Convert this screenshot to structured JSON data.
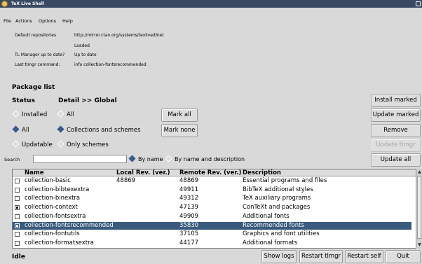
{
  "window": {
    "title": "TeX Live Shell"
  },
  "menu": [
    {
      "label": "File"
    },
    {
      "label": "Actions"
    },
    {
      "label": "Options"
    },
    {
      "label": "Help"
    }
  ],
  "info": [
    {
      "label": "Default repositories",
      "value": "http://mirror.ctan.org/systems/texlive/tlnet"
    },
    {
      "label": "",
      "value": "Loaded"
    },
    {
      "label": "TL Manager up to date?",
      "value": "Up to date"
    },
    {
      "label": "Last tlmgr command:",
      "value": "info collection-fontsrecommended"
    }
  ],
  "package_list": {
    "title": "Package list",
    "status_header": "Status",
    "detail_header": "Detail >> Global",
    "status_options": [
      {
        "label": "Installed",
        "selected": false
      },
      {
        "label": "All",
        "selected": true
      },
      {
        "label": "Updatable",
        "selected": false
      }
    ],
    "detail_options": [
      {
        "label": "All",
        "selected": false
      },
      {
        "label": "Collections and schemes",
        "selected": true
      },
      {
        "label": "Only schemes",
        "selected": false
      }
    ],
    "mark_all": "Mark all",
    "mark_none": "Mark none"
  },
  "actions": {
    "install_marked": "Install marked",
    "update_marked": "Update marked",
    "remove_marked": "Remove marked",
    "update_tlmgr": "Update tlmgr",
    "update_all": "Update all"
  },
  "search": {
    "label": "Search",
    "value": "",
    "by_name": "By name",
    "by_name_desc": "By name and description",
    "mode": "by_name"
  },
  "table": {
    "columns": [
      "Name",
      "Local Rev. (ver.)",
      "Remote Rev. (ver.)",
      "Description"
    ],
    "rows": [
      {
        "checked": false,
        "name": "collection-basic",
        "local": "48869",
        "remote": "48869",
        "desc": "Essential programs and files",
        "selected": false
      },
      {
        "checked": false,
        "name": "collection-bibtexextra",
        "local": "",
        "remote": "49911",
        "desc": "BibTeX additional styles",
        "selected": false
      },
      {
        "checked": false,
        "name": "collection-binextra",
        "local": "",
        "remote": "49312",
        "desc": "TeX auxiliary programs",
        "selected": false
      },
      {
        "checked": true,
        "name": "collection-context",
        "local": "",
        "remote": "47139",
        "desc": "ConTeXt and packages",
        "selected": false
      },
      {
        "checked": false,
        "name": "collection-fontsextra",
        "local": "",
        "remote": "49909",
        "desc": "Additional fonts",
        "selected": false
      },
      {
        "checked": true,
        "name": "collection-fontsrecommended",
        "local": "",
        "remote": "35830",
        "desc": "Recommended fonts",
        "selected": true
      },
      {
        "checked": false,
        "name": "collection-fontutils",
        "local": "",
        "remote": "37105",
        "desc": "Graphics and font utilities",
        "selected": false
      },
      {
        "checked": false,
        "name": "collection-formatsextra",
        "local": "",
        "remote": "44177",
        "desc": "Additional formats",
        "selected": false
      }
    ]
  },
  "bottom": {
    "status": "Idle",
    "show_logs": "Show logs",
    "restart_tlmgr": "Restart tlmgr",
    "restart_self": "Restart self",
    "quit": "Quit"
  }
}
